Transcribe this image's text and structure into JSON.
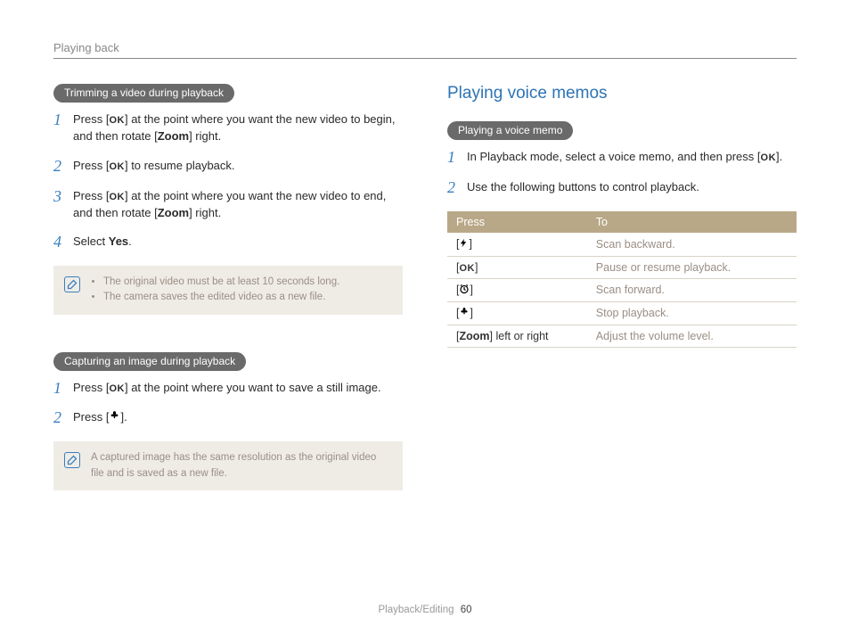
{
  "header": {
    "section": "Playing back"
  },
  "left": {
    "trimming": {
      "title": "Trimming a video during playback",
      "steps": [
        {
          "n": "1",
          "pre": "Press [",
          "icon": "OK",
          "post": "] at the point where you want the new video to begin, and then rotate [",
          "bold": "Zoom",
          "tail": "] right."
        },
        {
          "n": "2",
          "pre": "Press [",
          "icon": "OK",
          "post": "] to resume playback."
        },
        {
          "n": "3",
          "pre": "Press [",
          "icon": "OK",
          "post": "] at the point where you want the new video to end, and then rotate [",
          "bold": "Zoom",
          "tail": "] right."
        },
        {
          "n": "4",
          "pre": "Select ",
          "bold2": "Yes",
          "tail2": "."
        }
      ],
      "notes": [
        "The original video must be at least 10 seconds long.",
        "The camera saves the edited video as a new file."
      ]
    },
    "capturing": {
      "title": "Capturing an image during playback",
      "steps": [
        {
          "n": "1",
          "pre": "Press [",
          "icon": "OK",
          "post": "] at the point where you want to save a still image."
        },
        {
          "n": "2",
          "pre": "Press [",
          "glyph": "macro",
          "post": "]."
        }
      ],
      "note_single": "A captured image has the same resolution as the original video file and is saved as a new file."
    }
  },
  "right": {
    "heading": "Playing voice memos",
    "memo": {
      "title": "Playing a voice memo",
      "steps": [
        {
          "n": "1",
          "pre": "In Playback mode, select a voice memo, and then press [",
          "icon": "OK",
          "post": "]."
        },
        {
          "n": "2",
          "text": "Use the following buttons to control playback."
        }
      ]
    },
    "table": {
      "headers": [
        "Press",
        "To"
      ],
      "rows": [
        {
          "key_glyph": "flash",
          "desc": "Scan backward."
        },
        {
          "key_glyph": "ok",
          "desc": "Pause or resume playback."
        },
        {
          "key_glyph": "timer",
          "desc": "Scan forward."
        },
        {
          "key_glyph": "macro",
          "desc": "Stop playback."
        },
        {
          "key_text_pre": "[",
          "key_bold": "Zoom",
          "key_text_post": "] left or right",
          "desc": "Adjust the volume level."
        }
      ]
    }
  },
  "footer": {
    "label": "Playback/Editing",
    "page": "60"
  },
  "glyphs": {
    "ok": "OK"
  }
}
